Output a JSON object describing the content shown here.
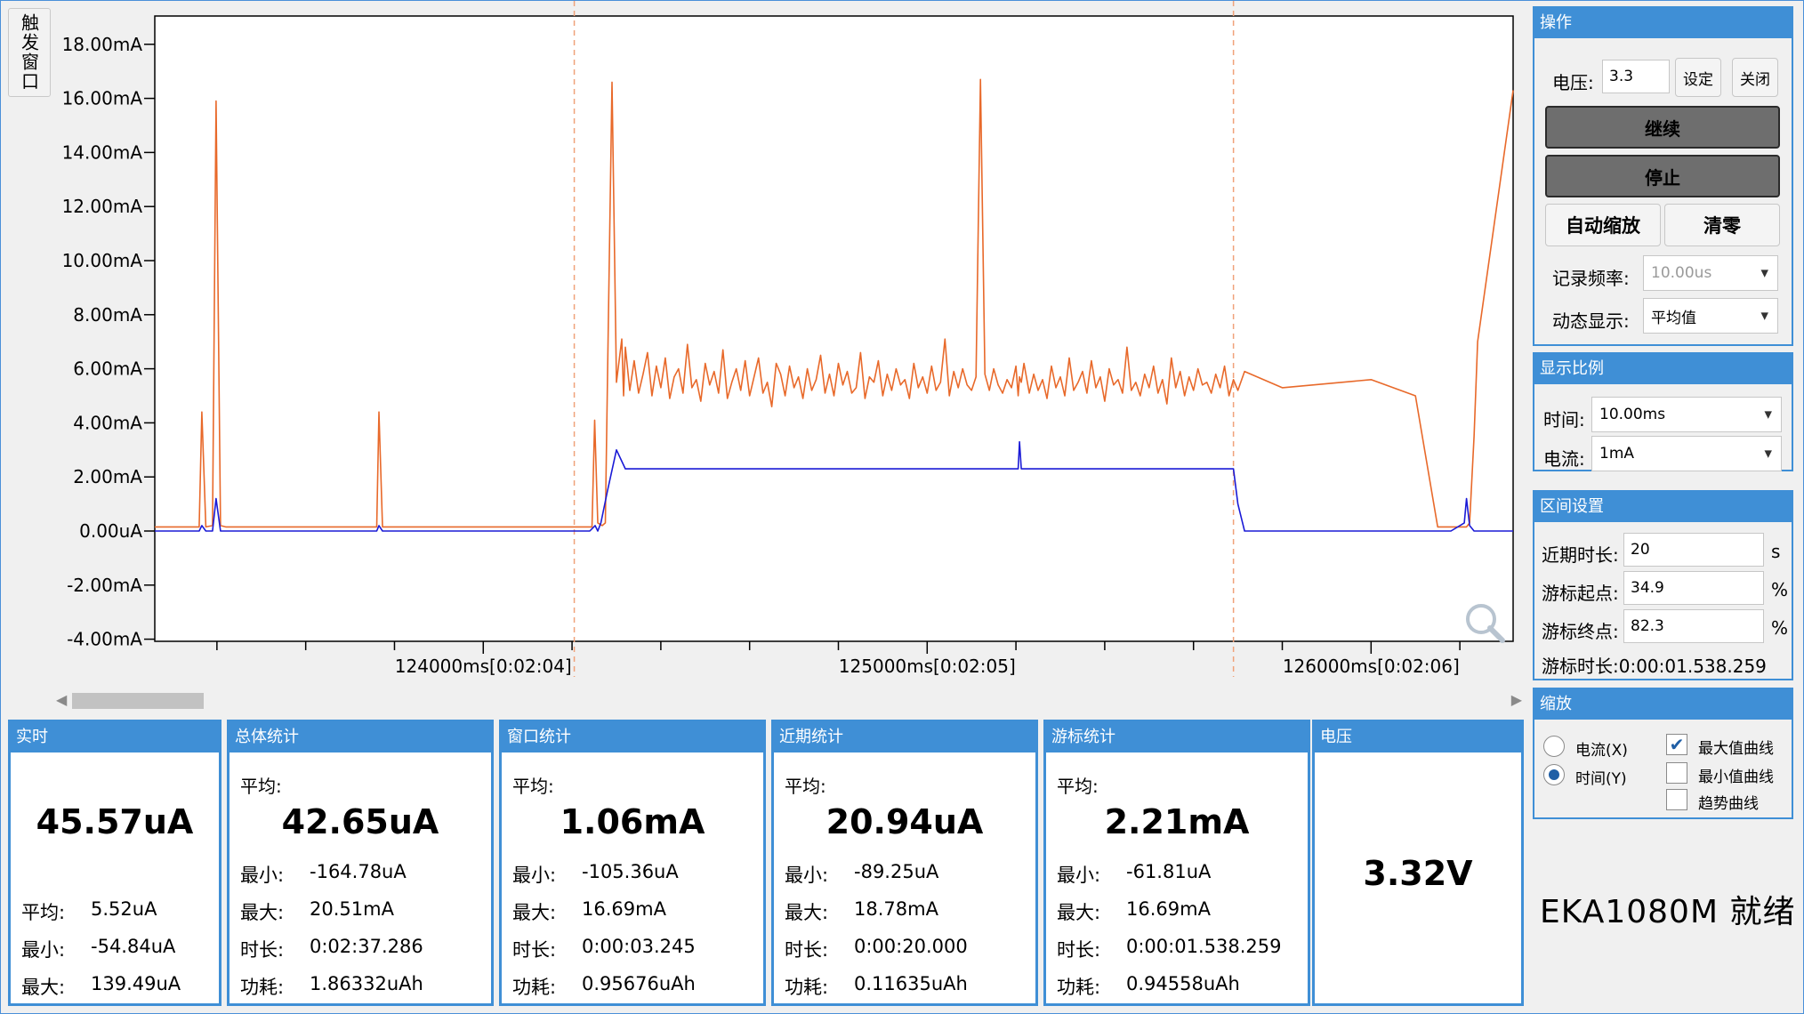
{
  "trigger_window": "触发窗口",
  "chart_data": {
    "type": "line",
    "y_ticks": [
      "18.00mA",
      "16.00mA",
      "14.00mA",
      "12.00mA",
      "10.00mA",
      "8.00mA",
      "6.00mA",
      "4.00mA",
      "2.00mA",
      "0.00uA",
      "-2.00mA",
      "-4.00mA"
    ],
    "ylim_mA": [
      -4,
      18.5
    ],
    "x_ticks": [
      "124000ms[0:02:04]",
      "125000ms[0:02:05]",
      "126000ms[0:02:06]"
    ],
    "xlim_ms": [
      123260,
      126320
    ],
    "cursor_start_ms": 124205,
    "cursor_end_ms": 125690,
    "series": [
      {
        "color": "#e8692a",
        "x_ms": [
          123260,
          123300,
          123360,
          123366,
          123375,
          123390,
          123398,
          123408,
          123420,
          123500,
          123700,
          123760,
          123765,
          123773,
          123785,
          123900,
          124100,
          124245,
          124251,
          124258,
          124268,
          124275,
          124280,
          124290,
          124300,
          124312,
          124316,
          124320,
          124330,
          124340,
          124350,
          124360,
          124370,
          124380,
          124390,
          124400,
          124410,
          124420,
          124430,
          124440,
          124450,
          124460,
          124470,
          124480,
          124490,
          124500,
          124510,
          124520,
          124530,
          124540,
          124550,
          124560,
          124570,
          124580,
          124590,
          124600,
          124610,
          124620,
          124630,
          124640,
          124650,
          124660,
          124670,
          124680,
          124690,
          124700,
          124710,
          124720,
          124730,
          124740,
          124750,
          124760,
          124770,
          124780,
          124790,
          124800,
          124810,
          124820,
          124830,
          124840,
          124850,
          124860,
          124870,
          124880,
          124890,
          124900,
          124910,
          124920,
          124930,
          124940,
          124950,
          124960,
          124970,
          124980,
          124990,
          125000,
          125010,
          125020,
          125030,
          125040,
          125050,
          125060,
          125070,
          125080,
          125090,
          125100,
          125110,
          125120,
          125130,
          125140,
          125150,
          125160,
          125170,
          125180,
          125190,
          125200,
          125205,
          125208,
          125212,
          125218,
          125230,
          125240,
          125250,
          125260,
          125270,
          125280,
          125290,
          125300,
          125310,
          125320,
          125330,
          125340,
          125350,
          125360,
          125370,
          125380,
          125390,
          125400,
          125410,
          125420,
          125430,
          125440,
          125450,
          125460,
          125470,
          125480,
          125490,
          125500,
          125510,
          125520,
          125530,
          125540,
          125550,
          125560,
          125570,
          125580,
          125590,
          125600,
          125610,
          125620,
          125630,
          125640,
          125650,
          125660,
          125670,
          125680,
          125690,
          125700,
          125715,
          125800,
          126000,
          126100,
          126150,
          126180,
          126210,
          126215,
          126222,
          126232,
          126240,
          126320
        ],
        "y_mA": [
          0.15,
          0.15,
          0.15,
          4.4,
          0.15,
          0.2,
          15.9,
          0.2,
          0.15,
          0.15,
          0.15,
          0.15,
          4.4,
          0.15,
          0.15,
          0.15,
          0.15,
          0.15,
          4.1,
          0.3,
          0.2,
          0.3,
          5.8,
          16.6,
          5.5,
          7.1,
          5.0,
          6.8,
          5.2,
          6.3,
          5.1,
          5.8,
          6.6,
          5.0,
          6.1,
          5.3,
          6.4,
          4.9,
          5.7,
          6.0,
          5.1,
          6.9,
          5.3,
          5.6,
          4.8,
          6.2,
          5.4,
          5.9,
          5.1,
          6.7,
          4.9,
          5.5,
          6.0,
          5.2,
          6.3,
          5.0,
          5.7,
          6.4,
          5.1,
          5.5,
          4.6,
          6.2,
          5.8,
          5.0,
          6.1,
          5.3,
          5.7,
          4.9,
          6.0,
          5.2,
          5.6,
          6.5,
          5.1,
          5.8,
          5.0,
          6.2,
          5.4,
          5.9,
          5.1,
          5.3,
          6.6,
          4.9,
          5.7,
          5.5,
          6.3,
          5.0,
          5.8,
          5.2,
          6.0,
          5.4,
          5.6,
          4.9,
          6.2,
          5.3,
          5.7,
          5.1,
          6.1,
          5.2,
          5.5,
          7.1,
          5.0,
          5.9,
          5.3,
          6.0,
          5.4,
          5.2,
          5.7,
          16.7,
          5.8,
          5.2,
          6.0,
          5.4,
          5.1,
          5.6,
          5.3,
          6.1,
          5.0,
          5.7,
          5.5,
          6.2,
          5.1,
          5.8,
          5.2,
          5.6,
          4.9,
          6.1,
          5.3,
          5.7,
          5.0,
          6.4,
          5.2,
          5.5,
          5.9,
          5.1,
          6.3,
          5.3,
          5.7,
          4.8,
          6.0,
          5.4,
          5.6,
          5.1,
          6.8,
          5.2,
          5.5,
          5.0,
          5.8,
          5.3,
          6.1,
          5.1,
          5.6,
          4.7,
          6.4,
          5.3,
          5.9,
          5.0,
          5.7,
          5.2,
          6.0,
          5.4,
          5.5,
          5.1,
          5.8,
          5.3,
          6.1,
          5.0,
          5.6,
          5.2,
          5.9,
          5.3,
          5.6,
          5.0,
          0.15,
          0.15,
          0.15,
          0.15,
          0.3,
          3.5,
          7.0,
          16.3,
          0.3,
          0.2,
          0.15,
          0.15
        ]
      },
      {
        "color": "#1a1ad6",
        "x_ms": [
          123260,
          123360,
          123366,
          123375,
          123390,
          123398,
          123408,
          123420,
          123760,
          123765,
          123773,
          124100,
          124240,
          124252,
          124258,
          124265,
          124280,
          124300,
          124320,
          125200,
          125205,
          125208,
          125212,
          125218,
          125230,
          125670,
          125690,
          125700,
          125715,
          126000,
          126180,
          126210,
          126215,
          126222,
          126232,
          126240,
          126320
        ],
        "y_mA": [
          0.0,
          0.0,
          0.2,
          0.0,
          0.0,
          1.2,
          0.0,
          0.0,
          0.0,
          0.2,
          0.0,
          0.0,
          0.0,
          0.2,
          0.0,
          0.3,
          1.5,
          3.0,
          2.3,
          2.3,
          2.3,
          3.3,
          2.3,
          2.3,
          2.3,
          2.3,
          2.3,
          1.0,
          0.0,
          0.0,
          0.0,
          0.3,
          1.2,
          0.2,
          0.0,
          0.0,
          0.0
        ]
      }
    ]
  },
  "stats": {
    "realtime": {
      "title": "实时",
      "value": "45.57uA",
      "avg_k": "平均:",
      "avg": "5.52uA",
      "min_k": "最小:",
      "min": "-54.84uA",
      "max_k": "最大:",
      "max": "139.49uA"
    },
    "total": {
      "title": "总体统计",
      "avg_k": "平均:",
      "value": "42.65uA",
      "min_k": "最小:",
      "min": "-164.78uA",
      "max_k": "最大:",
      "max": "20.51mA",
      "dur_k": "时长:",
      "dur": "0:02:37.286",
      "pow_k": "功耗:",
      "pow": "1.86332uAh"
    },
    "window": {
      "title": "窗口统计",
      "avg_k": "平均:",
      "value": "1.06mA",
      "min_k": "最小:",
      "min": "-105.36uA",
      "max_k": "最大:",
      "max": "16.69mA",
      "dur_k": "时长:",
      "dur": "0:00:03.245",
      "pow_k": "功耗:",
      "pow": "0.95676uAh"
    },
    "recent": {
      "title": "近期统计",
      "avg_k": "平均:",
      "value": "20.94uA",
      "min_k": "最小:",
      "min": "-89.25uA",
      "max_k": "最大:",
      "max": "18.78mA",
      "dur_k": "时长:",
      "dur": "0:00:20.000",
      "pow_k": "功耗:",
      "pow": "0.11635uAh"
    },
    "cursor": {
      "title": "游标统计",
      "avg_k": "平均:",
      "value": "2.21mA",
      "min_k": "最小:",
      "min": "-61.81uA",
      "max_k": "最大:",
      "max": "16.69mA",
      "dur_k": "时长:",
      "dur": "0:00:01.538.259",
      "pow_k": "功耗:",
      "pow": "0.94558uAh"
    },
    "voltage": {
      "title": "电压",
      "value": "3.32V"
    }
  },
  "ops": {
    "title": "操作",
    "voltage_label": "电压:",
    "voltage_value": "3.3",
    "set_btn": "设定",
    "close_btn": "关闭",
    "continue_btn": "继续",
    "stop_btn": "停止",
    "autoscale_btn": "自动缩放",
    "clear_btn": "清零",
    "rate_label": "记录频率:",
    "rate_value": "10.00us",
    "dyn_label": "动态显示:",
    "dyn_value": "平均值"
  },
  "scale": {
    "title": "显示比例",
    "time_label": "时间:",
    "time_value": "10.00ms",
    "current_label": "电流:",
    "current_value": "1mA"
  },
  "range": {
    "title": "区间设置",
    "recent_label": "近期时长:",
    "recent_value": "20",
    "recent_unit": "s",
    "start_label": "游标起点:",
    "start_value": "34.9",
    "start_unit": "%",
    "end_label": "游标终点:",
    "end_value": "82.3",
    "end_unit": "%",
    "cursor_dur": "游标时长:0:00:01.538.259"
  },
  "zoom": {
    "title": "缩放",
    "radio_current": "电流(X)",
    "radio_time": "时间(Y)",
    "chk_max": "最大值曲线",
    "chk_min": "最小值曲线",
    "chk_trend": "趋势曲线"
  },
  "status": "EKA1080M  就绪"
}
